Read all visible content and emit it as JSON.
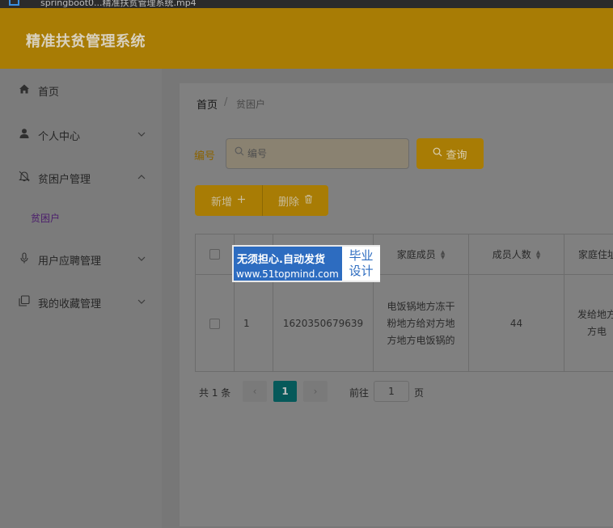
{
  "browser": {
    "url": "springboot0...精准扶贫管理系统.mp4"
  },
  "header": {
    "system_title": "精准扶贫管理系统"
  },
  "sidebar": {
    "items": [
      {
        "label": "首页",
        "icon": "home-icon"
      },
      {
        "label": "个人中心",
        "icon": "user-icon"
      },
      {
        "label": "贫困户管理",
        "icon": "bell-icon"
      },
      {
        "label": "用户应聘管理",
        "icon": "microphone-icon"
      },
      {
        "label": "我的收藏管理",
        "icon": "copy-icon"
      }
    ],
    "sub_item": {
      "label": "贫困户"
    }
  },
  "breadcrumb": {
    "home": "首页",
    "separator": "/",
    "current": "贫困户"
  },
  "search": {
    "label": "编号",
    "placeholder": "编号",
    "button_label": "查询"
  },
  "actions": {
    "add_label": "新增",
    "delete_label": "删除"
  },
  "table": {
    "headers": [
      "家庭成员",
      "成员人数",
      "家庭住址"
    ],
    "row": {
      "index": "1",
      "id": "1620350679639",
      "members": [
        "电饭锅地方冻干",
        "粉地方给对方地",
        "方地方电饭锅的"
      ],
      "count": "44",
      "address": [
        "发给地方",
        "方电"
      ]
    }
  },
  "pagination": {
    "total": "共 1 条",
    "prev": "‹",
    "current_page": "1",
    "next": "›",
    "goto_label": "前往",
    "goto_value": "1",
    "page_unit": "页"
  },
  "watermark": {
    "line1": "无须担心.自动发货",
    "line2": "www.51topmind.com",
    "box_line1": "毕业",
    "box_line2": "设计"
  },
  "colors": {
    "primary": "#a87c05",
    "active_page": "#06595a",
    "watermark_blue": "#2d6cc0"
  }
}
